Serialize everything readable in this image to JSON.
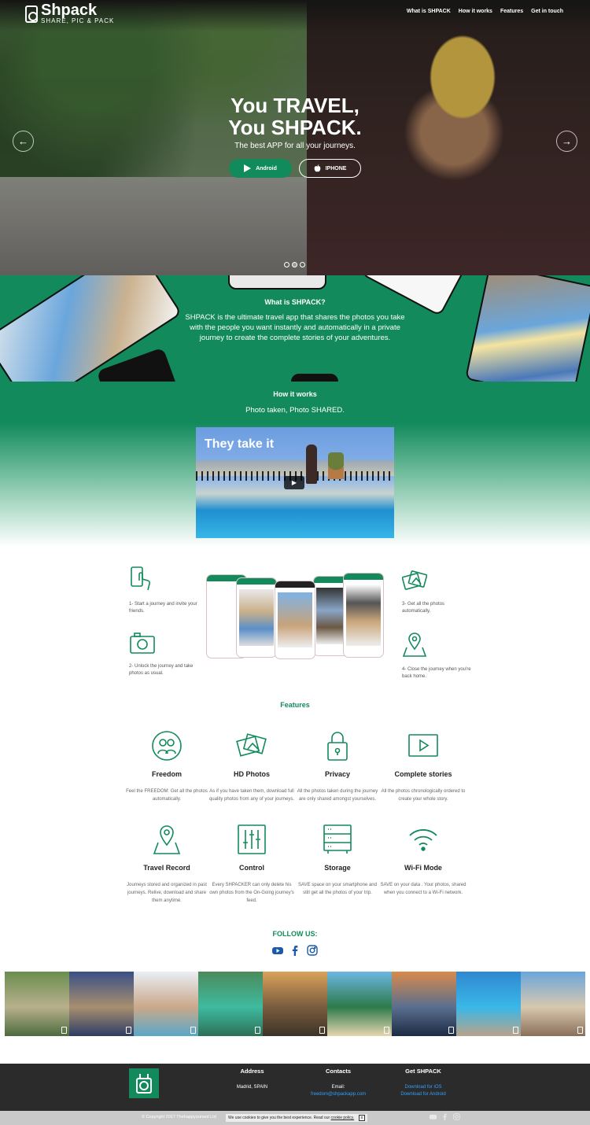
{
  "brand": {
    "name": "Shpack",
    "tagline": "SHARE, PIC & PACK"
  },
  "nav": [
    {
      "label": "What is SHPACK"
    },
    {
      "label": "How it works"
    },
    {
      "label": "Features"
    },
    {
      "label": "Get in touch"
    }
  ],
  "hero": {
    "title_line1": "You TRAVEL,",
    "title_line2": "You SHPACK.",
    "subtitle": "The best APP for all your journeys.",
    "android_label": "Android",
    "iphone_label": "IPHONE",
    "slides": 3,
    "active_slide": 2
  },
  "what": {
    "heading": "What is SHPACK?",
    "text": "SHPACK is the ultimate travel app that shares the photos you take with the people you want instantly and automatically in a private journey to create the complete stories of your adventures."
  },
  "how": {
    "heading": "How it works",
    "subtitle": "Photo taken, Photo SHARED.",
    "video_title": "They take it"
  },
  "steps": [
    {
      "icon": "touch-phone-icon",
      "text": "1- Start a journey and invite your friends."
    },
    {
      "icon": "camera-icon",
      "text": "2- Unlock the journey and take photos as usual."
    },
    {
      "icon": "photos-icon",
      "text": "3- Get all the photos automatically."
    },
    {
      "icon": "map-pin-icon",
      "text": "4- Close the journey when you're back home."
    }
  ],
  "features": {
    "heading": "Features",
    "items": [
      {
        "icon": "friends-icon",
        "title": "Freedom",
        "text": "Feel the FREEDOM: Get all the photos automatically."
      },
      {
        "icon": "photos-icon",
        "title": "HD Photos",
        "text": "As if you have taken them, download full quality photos from any of your journeys."
      },
      {
        "icon": "lock-icon",
        "title": "Privacy",
        "text": "All the photos taken during the journey are only shared amongst yourselves."
      },
      {
        "icon": "play-icon",
        "title": "Complete stories",
        "text": "All the photos chronologically ordered to create your whole story."
      },
      {
        "icon": "map-pin-icon",
        "title": "Travel Record",
        "text": "Journeys stored and organized in past journeys. Relive, download and share them anytime."
      },
      {
        "icon": "sliders-icon",
        "title": "Control",
        "text": "Every SHPACKER can only delete his own photos from the On-Going journey's feed."
      },
      {
        "icon": "storage-icon",
        "title": "Storage",
        "text": "SAVE space on your smartphone and still get all the photos of your trip."
      },
      {
        "icon": "wifi-icon",
        "title": "Wi-Fi Mode",
        "text": "SAVE on your data . Your photos, shared when you connect to a Wi-Fi network."
      }
    ]
  },
  "follow": {
    "heading": "FOLLOW US:"
  },
  "gallery": [
    {
      "colors": [
        "#6a8d4f",
        "#b8b08c",
        "#4d6b3e"
      ]
    },
    {
      "colors": [
        "#3a4f86",
        "#a88f6f",
        "#2d3c66"
      ]
    },
    {
      "colors": [
        "#e9eef4",
        "#caa88a",
        "#5aa7c8"
      ]
    },
    {
      "colors": [
        "#4a8a5a",
        "#3fbba0",
        "#2c7057"
      ]
    },
    {
      "colors": [
        "#d9a25a",
        "#7a5c3f",
        "#3c3326"
      ]
    },
    {
      "colors": [
        "#6cb6e2",
        "#2d7a4a",
        "#e6d6b0"
      ]
    },
    {
      "colors": [
        "#d98a4a",
        "#5a6f8f",
        "#1c2b45"
      ]
    },
    {
      "colors": [
        "#2f88d0",
        "#3ab7e8",
        "#b9a38a"
      ]
    },
    {
      "colors": [
        "#6aa6dc",
        "#d8c8ae",
        "#8a6f5a"
      ]
    }
  ],
  "footer": {
    "address_heading": "Address",
    "address": "Madrid, SPAIN",
    "contacts_heading": "Contacts",
    "email_label": "Email:",
    "email": "freedom@shpackapp.com",
    "get_heading": "Get SHPACK",
    "ios_link": "Download for iOS",
    "android_link": "Download for Android",
    "copyright": "© Copyright 2017 Thehappyoursed Ltd",
    "cookie_text": "We use cookies to give you the best experience. Read our",
    "cookie_link": "cookie policy.",
    "cookie_close": "x"
  },
  "colors": {
    "accent": "#128a5c",
    "footer_bg": "#2b2b2b",
    "link": "#2fa0ff"
  }
}
